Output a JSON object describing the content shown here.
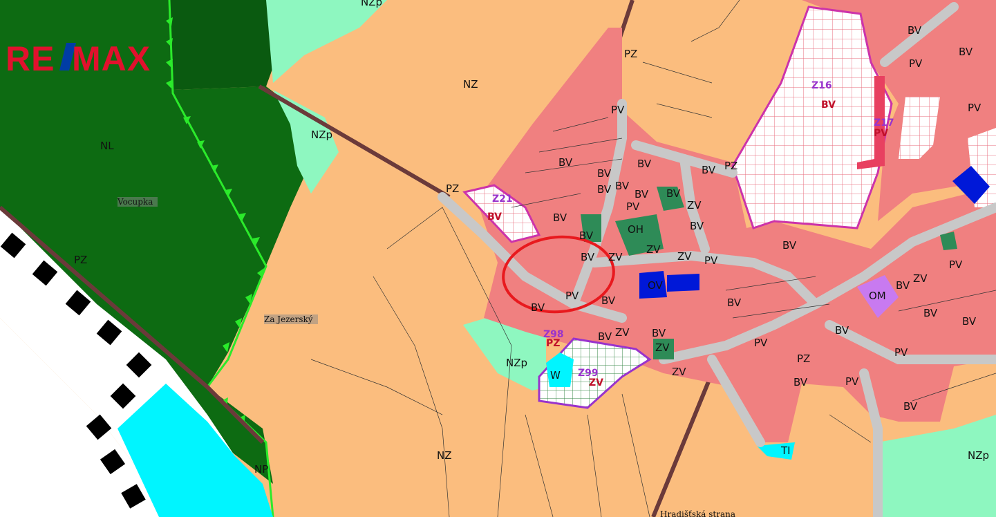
{
  "logo": {
    "text_left": "RE",
    "text_right": "MAX",
    "color_red": "#e1112d",
    "color_blue": "#003da5"
  },
  "colors": {
    "nz_orange": "#fbbd7e",
    "nl_forest": "#0d6b12",
    "nzp_mint": "#8ef7c0",
    "bv_residential": "#f08080",
    "pv_road": "#c8c8c8",
    "zv_green": "#2e8b57",
    "ov_blue": "#0018d8",
    "om_purple": "#c87af0",
    "water": "#00f5ff",
    "plot_red": "#e84060",
    "rail_brown": "#6b3a3a",
    "marker_circle": "#e8191e"
  },
  "place_names": {
    "vocupka": "Vocupka",
    "za_jezersky": "Za Jezerský",
    "hradistska": "Hradišťská strana"
  },
  "zone_labels": {
    "nz_top": "NZ",
    "nz_bottom": "NZ",
    "nzp_top": "NZp",
    "nzp_mid": "NZp",
    "nzp_low": "NZp",
    "nzp_right": "NZp",
    "nl": "NL",
    "pz_1": "PZ",
    "pz_2": "PZ",
    "pz_3": "PZ",
    "pz_4": "PZ",
    "pz_5": "PZ",
    "pz_6": "PZ",
    "np": "NP",
    "w": "W",
    "tl": "TI",
    "oh": "OH",
    "ov": "OV",
    "om": "OM",
    "bv_list": [
      "BV",
      "BV",
      "BV",
      "BV",
      "BV",
      "BV",
      "BV",
      "BV",
      "BV",
      "BV",
      "BV",
      "BV",
      "BV",
      "BV",
      "BV",
      "BV",
      "BV",
      "BV",
      "BV",
      "BV",
      "BV",
      "BV",
      "BV",
      "BV",
      "BV",
      "BV"
    ],
    "pv_list": [
      "PV",
      "PV",
      "PV",
      "PV",
      "PV",
      "PV",
      "PV",
      "PV",
      "PV",
      "PV",
      "PV"
    ],
    "zv_list": [
      "ZV",
      "ZV",
      "ZV",
      "ZV",
      "ZV",
      "ZV",
      "ZV",
      "ZV"
    ]
  },
  "development_plots": {
    "z16": {
      "code": "Z16",
      "use": "BV"
    },
    "z17": {
      "code": "Z17",
      "use": "PV"
    },
    "z21": {
      "code": "Z21",
      "use": "BV"
    },
    "z98": {
      "code": "Z98",
      "use": "PZ"
    },
    "z99": {
      "code": "Z99",
      "use": "ZV"
    }
  }
}
